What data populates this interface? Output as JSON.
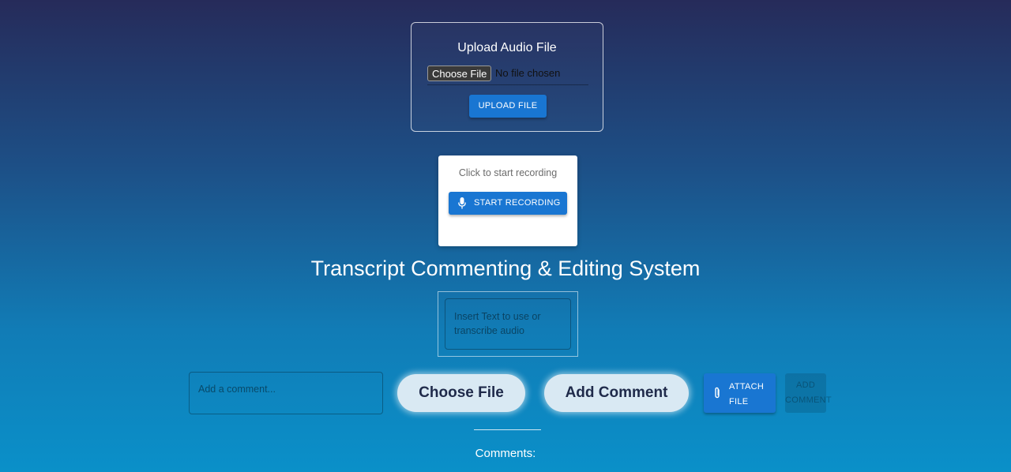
{
  "upload": {
    "title": "Upload Audio File",
    "file_button_label": "Choose File",
    "file_status": "No file chosen",
    "upload_button_label": "UPLOAD FILE"
  },
  "recording": {
    "hint": "Click to start recording",
    "start_button_label": "START RECORDING",
    "button_icon": "microphone-icon"
  },
  "main": {
    "title": "Transcript Commenting & Editing System",
    "text_placeholder": "Insert Text to use or transcribe audio"
  },
  "comment_bar": {
    "comment_placeholder": "Add a comment...",
    "choose_file_label": "Choose File",
    "add_comment_label": "Add Comment",
    "attach_file_label": "ATTACH FILE",
    "attach_icon": "paperclip-icon",
    "add_comment_disabled_label": "ADD COMMENT"
  },
  "comments": {
    "heading": "Comments:"
  },
  "colors": {
    "primary_button": "#1976d2",
    "pill_background": "#d9e9f3",
    "gradient_top": "#262b5a",
    "gradient_bottom": "#0a90c9"
  }
}
